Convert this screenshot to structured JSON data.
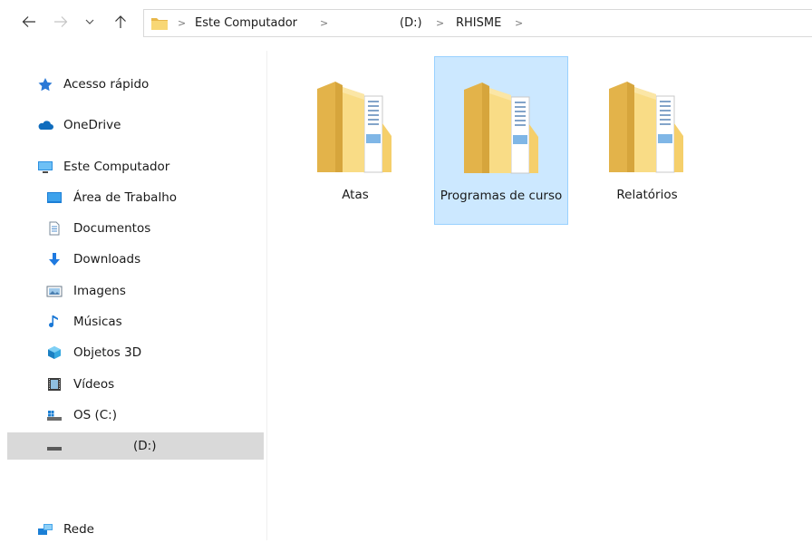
{
  "address": {
    "segments": [
      "Este Computador",
      "(D:)",
      "RHISME"
    ]
  },
  "sidebar": {
    "items": [
      {
        "label": "Acesso rápido",
        "icon": "star-icon"
      },
      {
        "label": "OneDrive",
        "icon": "cloud-icon"
      },
      {
        "label": "Este Computador",
        "icon": "computer-icon"
      },
      {
        "label": "Área de Trabalho",
        "icon": "desktop-icon"
      },
      {
        "label": "Documentos",
        "icon": "document-icon"
      },
      {
        "label": "Downloads",
        "icon": "download-icon"
      },
      {
        "label": "Imagens",
        "icon": "image-icon"
      },
      {
        "label": "Músicas",
        "icon": "music-icon"
      },
      {
        "label": "Objetos 3D",
        "icon": "cube-icon"
      },
      {
        "label": "Vídeos",
        "icon": "video-icon"
      },
      {
        "label": "OS (C:)",
        "icon": "drive-icon"
      },
      {
        "label": "(D:)",
        "icon": "drive-icon",
        "selected": true
      },
      {
        "label": "Rede",
        "icon": "network-icon"
      }
    ]
  },
  "folders": [
    {
      "label": "Atas",
      "selected": false
    },
    {
      "label": "Programas de curso",
      "selected": true
    },
    {
      "label": "Relatórios",
      "selected": false
    }
  ],
  "colors": {
    "folder": "#f8d775",
    "selection_bg": "#cce8ff",
    "selection_border": "#99d1ff",
    "sidebar_selected": "#d9d9d9",
    "accent": "#0078d7"
  }
}
